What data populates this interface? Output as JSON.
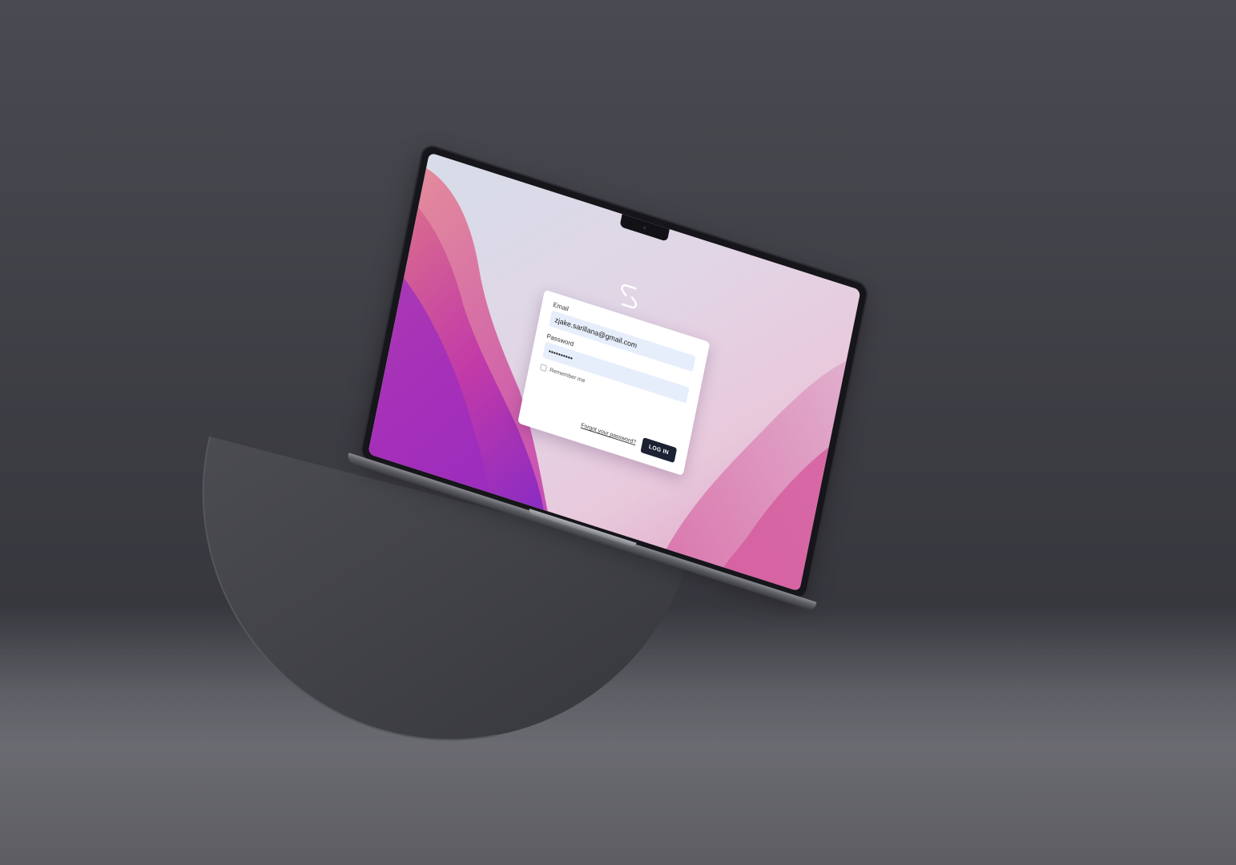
{
  "login": {
    "email_label": "Email",
    "email_value": "zjake.sarillana@gmail.com",
    "password_label": "Password",
    "password_value": "••••••••••",
    "remember_label": "Remember me",
    "remember_checked": false,
    "forgot_link": "Forgot your password?",
    "login_button": "LOG IN"
  },
  "colors": {
    "button_bg": "#1c2233",
    "input_bg": "#e6eefb",
    "backdrop": "#3d3d44",
    "wallpaper_accent": "#c43fb0"
  },
  "icons": {
    "app_logo": "app-logo-icon"
  }
}
